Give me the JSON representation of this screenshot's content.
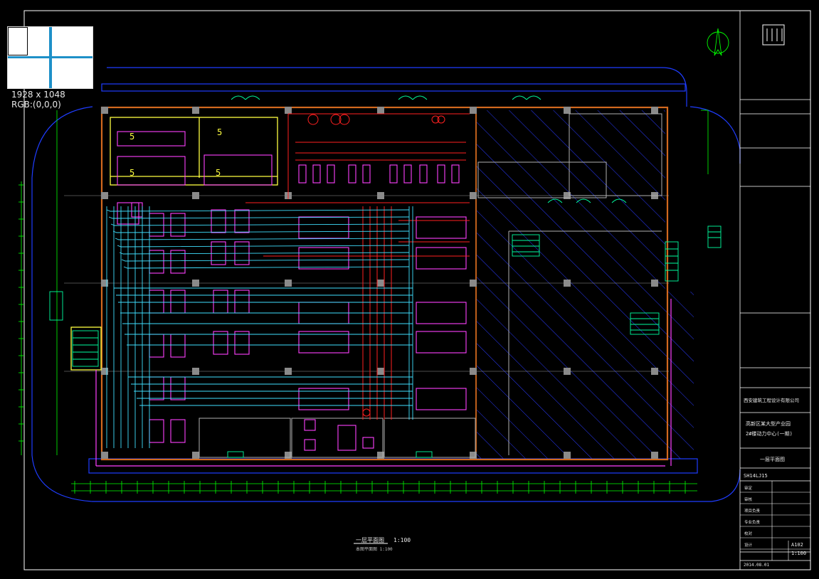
{
  "viewer": {
    "image_size": "1928 x 1048",
    "pixel_color": "RGB:(0,0,0)"
  },
  "drawing": {
    "plan_title": "一层平面图",
    "plan_scale": "1:100",
    "plan_subtitle": "本图平面图 1:100",
    "rooms": {
      "room_a": "5",
      "room_b": "5",
      "room_c": "5",
      "room_d": "5"
    }
  },
  "title_block": {
    "company": "西安建筑工程设计有限公司",
    "project_line1": "高新区某大型产业园",
    "project_line2": "2#楼动力中心(一期)",
    "sheet_name": "一层平面图",
    "drawing_no": "SH14LJ15",
    "sheet_no": "A102",
    "scale": "1:100",
    "date": "2014.08.01",
    "rows": [
      {
        "label": "审定",
        "value": ""
      },
      {
        "label": "审核",
        "value": ""
      },
      {
        "label": "项目负责",
        "value": ""
      },
      {
        "label": "专业负责",
        "value": ""
      },
      {
        "label": "校对",
        "value": ""
      },
      {
        "label": "设计",
        "value": ""
      }
    ]
  },
  "colors": {
    "frame": "#ffffff",
    "grid": "#9a9a9a",
    "wall": "#d2691e",
    "dim": "#00ff00",
    "outline": "#1f3dff",
    "pipe_red": "#ff2020",
    "pipe_cyan": "#40e0ff",
    "equipment": "#ff40ff",
    "yellow": "#ffff40",
    "hatch": "#2a3aff"
  }
}
